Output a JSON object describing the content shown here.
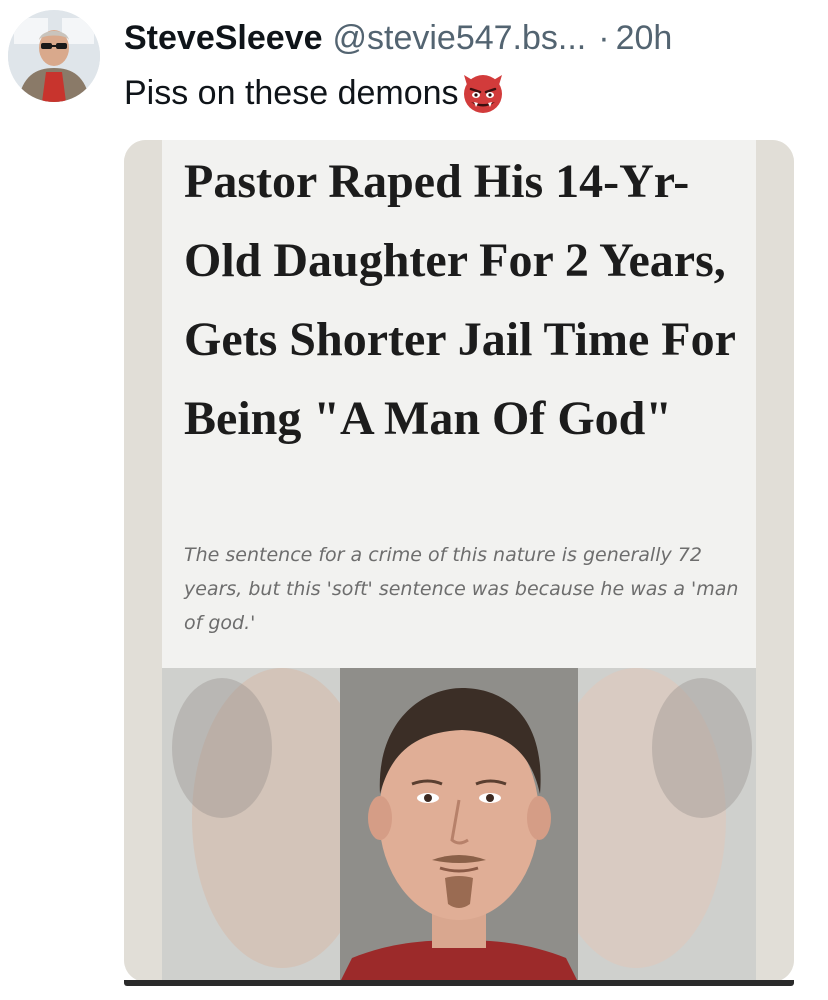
{
  "post": {
    "display_name": "SteveSleeve",
    "handle": "@stevie547.bs...",
    "separator": "·",
    "time": "20h",
    "text": "Piss on these demons",
    "emoji_icon": "ogre-face-icon"
  },
  "media": {
    "headline": "Pastor Raped His 14-Yr-Old Daughter For 2 Years, Gets Shorter Jail Time For Being \"A Man Of God\"",
    "subtext": "The sentence for a crime of this nature is generally 72 years, but this 'soft' sentence was because he was a 'man of god.'"
  },
  "colors": {
    "text_primary": "#0f1419",
    "text_secondary": "#536471",
    "headline": "#1c1c1c",
    "subtext": "#6d6d6d"
  }
}
